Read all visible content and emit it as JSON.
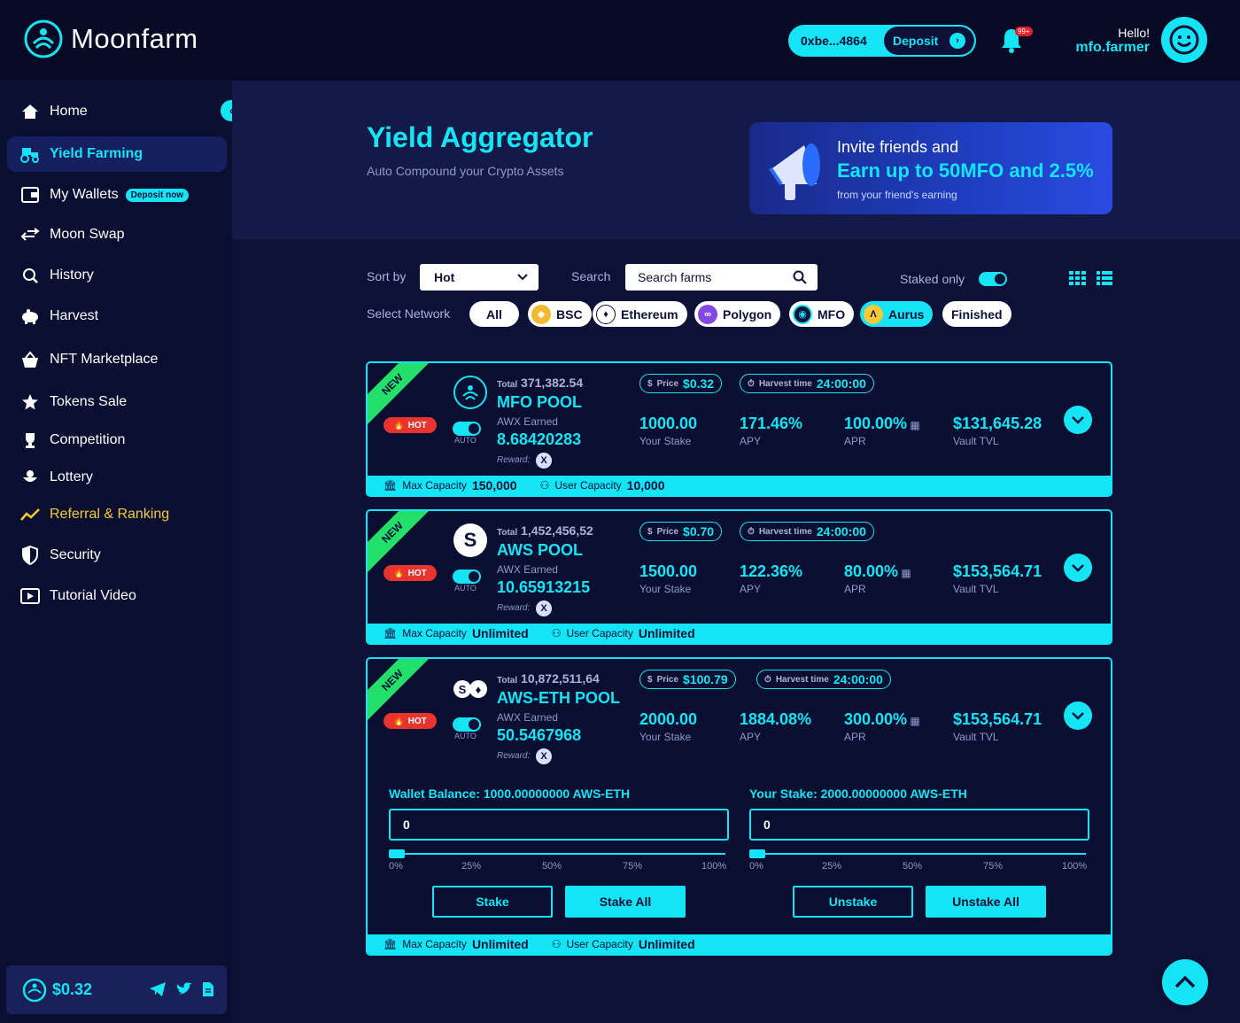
{
  "brand": {
    "name": "Moonfarm",
    "accent": "#14e4f4",
    "bg": "#0d1138"
  },
  "header": {
    "wallet_address": "0xbe...4864",
    "deposit_label": "Deposit",
    "notif_badge": "99+",
    "greeting": "Hello!",
    "username": "mfo.farmer"
  },
  "sidebar": {
    "items": [
      {
        "label": "Home",
        "icon": "home-icon"
      },
      {
        "label": "Yield Farming",
        "icon": "tractor-icon",
        "active": true
      },
      {
        "label": "My Wallets",
        "icon": "wallet-icon",
        "tag": "Deposit now"
      },
      {
        "label": "Moon Swap",
        "icon": "swap-icon"
      },
      {
        "label": "History",
        "icon": "history-icon"
      },
      {
        "label": "Harvest",
        "icon": "piggy-bank-icon"
      },
      {
        "label": "NFT Marketplace",
        "icon": "basket-icon"
      },
      {
        "label": "Tokens Sale",
        "icon": "star-icon"
      },
      {
        "label": "Competition",
        "icon": "trophy-icon"
      },
      {
        "label": "Lottery",
        "icon": "lottery-icon"
      },
      {
        "label": "Referral & Ranking",
        "icon": "chart-line-icon",
        "highlight": "#f7c93b"
      },
      {
        "label": "Security",
        "icon": "shield-icon"
      },
      {
        "label": "Tutorial Video",
        "icon": "video-icon"
      }
    ],
    "price": "$0.32"
  },
  "hero": {
    "title": "Yield Aggregator",
    "subtitle": "Auto Compound your Crypto Assets",
    "banner": {
      "line1": "Invite friends and",
      "line2": "Earn up to 50MFO and 2.5%",
      "line3": "from your friend's earning"
    }
  },
  "controls": {
    "sort_label": "Sort by",
    "sort_value": "Hot",
    "search_label": "Search",
    "search_placeholder": "Search farms",
    "staked_only": "Staked only",
    "network_label": "Select Network",
    "networks": [
      "All",
      "BSC",
      "Ethereum",
      "Polygon",
      "MFO",
      "Aurus",
      "Finished"
    ]
  },
  "labels": {
    "hot": "HOT",
    "new": "NEW",
    "auto": "AUTO",
    "total": "Total",
    "awx_earned": "AWX Earned",
    "reward": "Reward:",
    "reward_token": "X",
    "price": "Price",
    "harvest_time": "Harvest time",
    "your_stake": "Your Stake",
    "apy": "APY",
    "apr": "APR",
    "vault_tvl": "Vault TVL",
    "max_capacity": "Max Capacity",
    "user_capacity": "User Capacity"
  },
  "pools": [
    {
      "total": "371,382.54",
      "name": "MFO POOL",
      "earned": "8.68420283",
      "price": "$0.32",
      "harvest": "24:00:00",
      "stake": "1000.00",
      "apy": "171.46%",
      "apr": "100.00%",
      "tvl": "$131,645.28",
      "max_cap": "150,000",
      "user_cap": "10,000"
    },
    {
      "total": "1,452,456,52",
      "name": "AWS POOL",
      "earned": "10.65913215",
      "price": "$0.70",
      "harvest": "24:00:00",
      "stake": "1500.00",
      "apy": "122.36%",
      "apr": "80.00%",
      "tvl": "$153,564.71",
      "max_cap": "Unlimited",
      "user_cap": "Unlimited"
    },
    {
      "total": "10,872,511,64",
      "name": "AWS-ETH POOL",
      "earned": "50.5467968",
      "price": "$100.79",
      "harvest": "24:00:00",
      "stake": "2000.00",
      "apy": "1884.08%",
      "apr": "300.00%",
      "tvl": "$153,564.71",
      "max_cap": "Unlimited",
      "user_cap": "Unlimited"
    }
  ],
  "stake_form": {
    "wallet_balance": "Wallet Balance: 1000.00000000 AWS-ETH",
    "your_stake": "Your Stake: 2000.00000000 AWS-ETH",
    "stake_amount": "0",
    "unstake_amount": "0",
    "stake_level": 0,
    "unstake_level": 0,
    "ticks": [
      "0%",
      "25%",
      "50%",
      "75%",
      "100%"
    ],
    "stake_btn": "Stake",
    "stake_all_btn": "Stake All",
    "unstake_btn": "Unstake",
    "unstake_all_btn": "Unstake All"
  }
}
